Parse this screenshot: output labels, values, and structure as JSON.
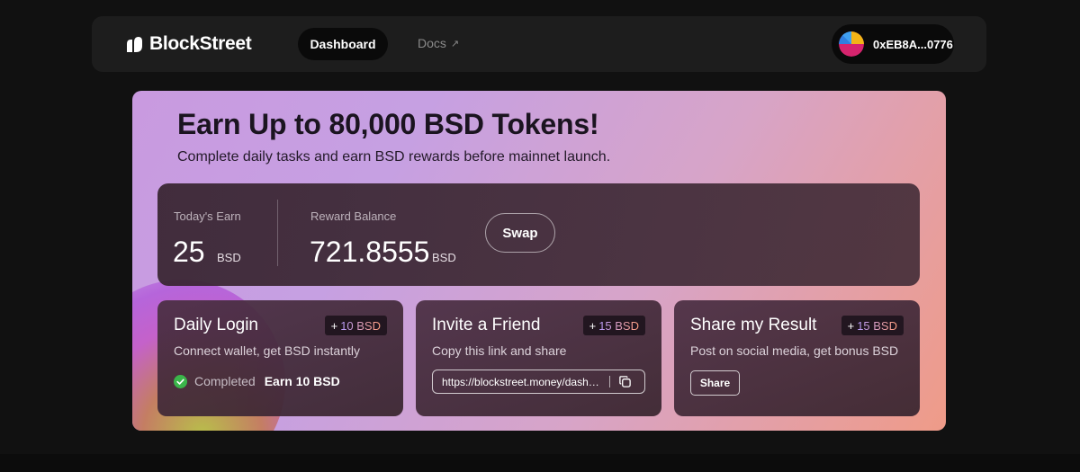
{
  "nav": {
    "brand": "BlockStreet",
    "dashboard_label": "Dashboard",
    "docs_label": "Docs",
    "docs_icon": "external-arrow-icon",
    "wallet_address": "0xEB8A...0776"
  },
  "hero": {
    "title": "Earn Up to 80,000 BSD Tokens!",
    "subtitle": "Complete daily tasks and earn BSD rewards before mainnet launch."
  },
  "stats": {
    "today_label": "Today's Earn",
    "today_value": "25",
    "today_unit": "BSD",
    "balance_label": "Reward Balance",
    "balance_value": "721.8555",
    "balance_unit": "BSD",
    "swap_label": "Swap"
  },
  "tasks": [
    {
      "title": "Daily Login",
      "badge_plus": "+",
      "badge_amount": "10 BSD",
      "desc": "Connect wallet, get BSD instantly",
      "status": "Completed",
      "earn": "Earn 10 BSD"
    },
    {
      "title": "Invite a Friend",
      "badge_plus": "+",
      "badge_amount": "15 BSD",
      "desc": "Copy this link and share",
      "link": "https://blockstreet.money/dashboard"
    },
    {
      "title": "Share my Result",
      "badge_plus": "+",
      "badge_amount": "15 BSD",
      "desc": "Post on social media, get bonus BSD",
      "button": "Share"
    }
  ],
  "colors": {
    "background": "#111111",
    "nav_bg": "#1d1d1d",
    "hero_gradient_start": "#c99ae0",
    "hero_gradient_end": "#ef9b88",
    "completed_green": "#3bb54a"
  }
}
